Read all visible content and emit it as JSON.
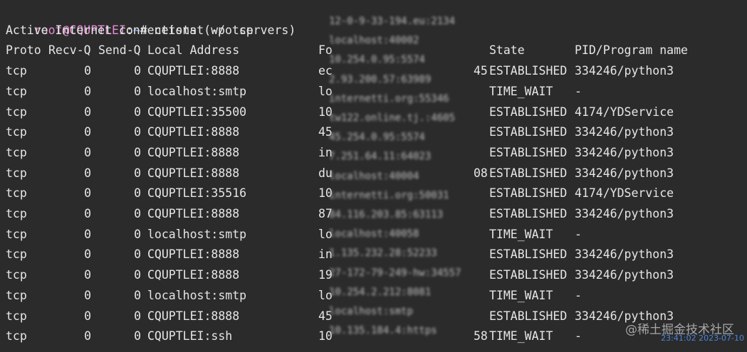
{
  "terminal": {
    "prompt": {
      "user_host": "root@CQUPTLEI",
      "separator": ":",
      "path": "~",
      "symbol": "#",
      "command": " netstat -p tcp"
    },
    "title_line": "Active Internet connections (w/o servers)",
    "headers": {
      "proto": "Proto",
      "recvq": "Recv-Q",
      "sendq": "Send-Q",
      "local": "Local Address",
      "foreign": "Fo",
      "state": "State",
      "pid": "PID/Program name"
    },
    "rows": [
      {
        "proto": "tcp",
        "recvq": "0",
        "sendq": "0",
        "local": "CQUPTLEI:8888",
        "foreign": "ec",
        "foreign_tail": "45",
        "state": "ESTABLISHED",
        "pid": "334246/python3"
      },
      {
        "proto": "tcp",
        "recvq": "0",
        "sendq": "0",
        "local": "localhost:smtp",
        "foreign": "lo",
        "foreign_tail": "",
        "state": "TIME_WAIT",
        "pid": "-"
      },
      {
        "proto": "tcp",
        "recvq": "0",
        "sendq": "0",
        "local": "CQUPTLEI:35500",
        "foreign": "10",
        "foreign_tail": "",
        "state": "ESTABLISHED",
        "pid": "4174/YDService"
      },
      {
        "proto": "tcp",
        "recvq": "0",
        "sendq": "0",
        "local": "CQUPTLEI:8888",
        "foreign": "45",
        "foreign_tail": "",
        "state": "ESTABLISHED",
        "pid": "334246/python3"
      },
      {
        "proto": "tcp",
        "recvq": "0",
        "sendq": "0",
        "local": "CQUPTLEI:8888",
        "foreign": "in",
        "foreign_tail": "",
        "state": "ESTABLISHED",
        "pid": "334246/python3"
      },
      {
        "proto": "tcp",
        "recvq": "0",
        "sendq": "0",
        "local": "CQUPTLEI:8888",
        "foreign": "du",
        "foreign_tail": "08",
        "state": "ESTABLISHED",
        "pid": "334246/python3"
      },
      {
        "proto": "tcp",
        "recvq": "0",
        "sendq": "0",
        "local": "CQUPTLEI:35516",
        "foreign": "10",
        "foreign_tail": "",
        "state": "ESTABLISHED",
        "pid": "4174/YDService"
      },
      {
        "proto": "tcp",
        "recvq": "0",
        "sendq": "0",
        "local": "CQUPTLEI:8888",
        "foreign": "87",
        "foreign_tail": "",
        "state": "ESTABLISHED",
        "pid": "334246/python3"
      },
      {
        "proto": "tcp",
        "recvq": "0",
        "sendq": "0",
        "local": "localhost:smtp",
        "foreign": "lo",
        "foreign_tail": "",
        "state": "TIME_WAIT",
        "pid": "-"
      },
      {
        "proto": "tcp",
        "recvq": "0",
        "sendq": "0",
        "local": "CQUPTLEI:8888",
        "foreign": "in",
        "foreign_tail": "",
        "state": "ESTABLISHED",
        "pid": "334246/python3"
      },
      {
        "proto": "tcp",
        "recvq": "0",
        "sendq": "0",
        "local": "CQUPTLEI:8888",
        "foreign": "19",
        "foreign_tail": "",
        "state": "ESTABLISHED",
        "pid": "334246/python3"
      },
      {
        "proto": "tcp",
        "recvq": "0",
        "sendq": "0",
        "local": "localhost:smtp",
        "foreign": "lo",
        "foreign_tail": "",
        "state": "TIME_WAIT",
        "pid": "-"
      },
      {
        "proto": "tcp",
        "recvq": "0",
        "sendq": "0",
        "local": "CQUPTLEI:8888",
        "foreign": "45",
        "foreign_tail": "",
        "state": "ESTABLISHED",
        "pid": "334246/python3"
      },
      {
        "proto": "tcp",
        "recvq": "0",
        "sendq": "0",
        "local": "CQUPTLEI:ssh",
        "foreign": "10",
        "foreign_tail": "58",
        "state": "TIME_WAIT",
        "pid": "-"
      }
    ],
    "blurred_column": [
      "12-0-9-33-194.eu:2134",
      "localhost:40002",
      "10.254.0.95:5574",
      "2.93.200.57:63989",
      "internetti.org:55346",
      "tw122.online.tj.:4605",
      "45.254.0.95:5574",
      "7.251.64.11:64023",
      "localhost:40004",
      "internetti.org:50031",
      "84.116.203.85:63113",
      "localhost:40058",
      "1.135.232.28:52233",
      "27-172-79-249-hw:34557",
      "10.254.2.212:8081",
      "localhost:smtp",
      "10.135.184.4:https"
    ]
  },
  "watermark": {
    "text": "@稀土掘金技术社区",
    "timestamp": "23:41:02 2023-07-10"
  }
}
